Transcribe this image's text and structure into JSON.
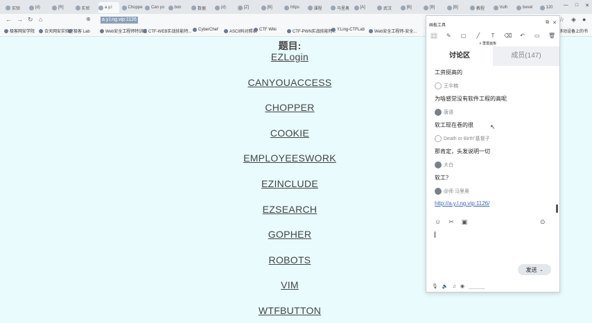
{
  "browser": {
    "tabs": [
      "实验",
      "(d)",
      "[R]",
      "实验",
      "a.y.l",
      "Chopper",
      "Can yo",
      "bon",
      "数据",
      "(d)",
      "[Z]",
      "[B]",
      "https",
      "课程",
      "马里奥",
      "[A]",
      "武汉",
      "[B]",
      "[B]",
      "[B]",
      "教程",
      "Vulh",
      "bevel",
      "120"
    ],
    "active_tab_index": 4,
    "url": "a.y.l.ng.vip:1126",
    "bookmarks": [
      "极客网安学院",
      "合天网安实验室",
      "极客 Lab",
      "Web安全工程师特训班",
      "CTF-WEB实战技能特...",
      "CyberChef",
      "ASCII码对照表",
      "CTF Wiki",
      "CTF-PWN实战技能特...",
      "Y.Ling-CTFLab",
      "Web安全工程师-安全..."
    ],
    "bookmarks_right": "移动设备上的书"
  },
  "page": {
    "heading": "题目:",
    "challenges": [
      "EZLogin",
      "CANYOUACCESS",
      "CHOPPER",
      "COOKIE",
      "EMPLOYEESWORK",
      "EZINCLUDE",
      "EZSEARCH",
      "GOPHER",
      "ROBOTS",
      "VIM",
      "WTFBUTTON"
    ]
  },
  "panel": {
    "title": "画板工具",
    "collapse_label": "∧ 重置画板",
    "tab_discuss": "讨论区",
    "tab_members": "成员(147)",
    "messages": [
      {
        "type": "text",
        "text": "工资挺高的"
      },
      {
        "type": "user",
        "name": "王伞楠"
      },
      {
        "type": "text",
        "text": "为啥感觉没有软件工程的高呢"
      },
      {
        "type": "user",
        "name": "唐语"
      },
      {
        "type": "text",
        "text": "软工现在卷的很"
      },
      {
        "type": "user",
        "name": "Death or Birth\"基督子"
      },
      {
        "type": "text",
        "text": "那肯定，头发说明一切"
      },
      {
        "type": "user",
        "name": "大白"
      },
      {
        "type": "text",
        "text": "软工？"
      },
      {
        "type": "user",
        "name": "@师 马里奥"
      },
      {
        "type": "link",
        "text": "http://a.y.l.ng.vip:1126/"
      }
    ],
    "send_label": "发送",
    "bottom_underline_text": "______"
  },
  "colors": {
    "page_bg": "#e9fbfd",
    "link_color": "#444444",
    "panel_bg": "#ffffff",
    "msg_link": "#3a66c4"
  }
}
